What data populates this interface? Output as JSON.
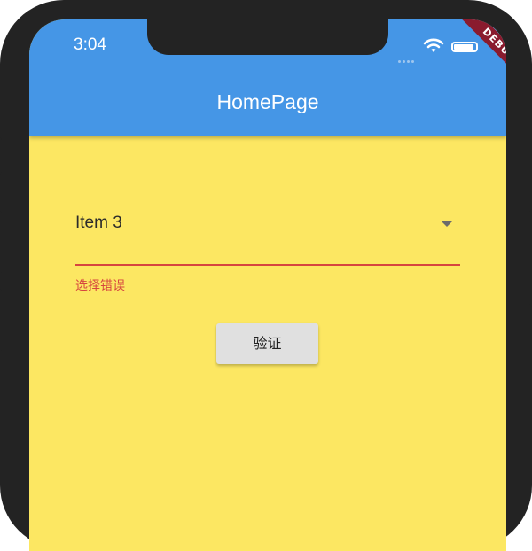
{
  "status_bar": {
    "time": "3:04",
    "icons": [
      "signal-dots-icon",
      "wifi-icon",
      "battery-icon"
    ]
  },
  "debug_banner": "DEBUG",
  "app_bar": {
    "title": "HomePage",
    "color": "#4596e6"
  },
  "body": {
    "background": "#fce762"
  },
  "form": {
    "dropdown": {
      "selected": "Item 3",
      "icon": "arrow-drop-down-icon"
    },
    "error_text": "选择错误",
    "error_color": "#d6453f",
    "submit_label": "验证"
  }
}
